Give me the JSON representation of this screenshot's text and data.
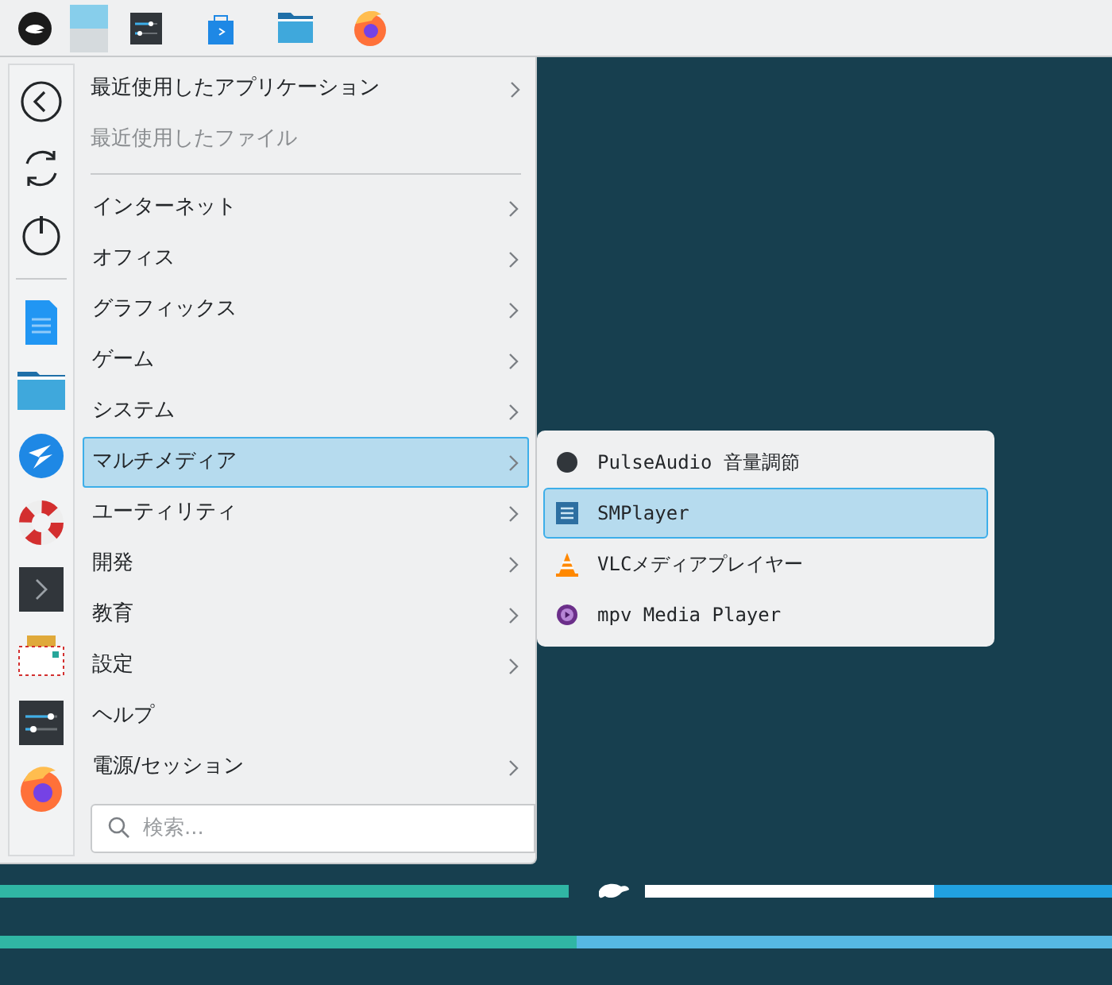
{
  "panel": {
    "pager": [
      {
        "selected": true
      },
      {
        "selected": false
      }
    ]
  },
  "menu": {
    "recent": [
      {
        "label": "最近使用したアプリケーション",
        "has_submenu": true,
        "disabled": false
      },
      {
        "label": "最近使用したファイル",
        "has_submenu": false,
        "disabled": true
      }
    ],
    "categories": [
      {
        "label": "インターネット",
        "has_submenu": true,
        "selected": false
      },
      {
        "label": "オフィス",
        "has_submenu": true,
        "selected": false
      },
      {
        "label": "グラフィックス",
        "has_submenu": true,
        "selected": false
      },
      {
        "label": "ゲーム",
        "has_submenu": true,
        "selected": false
      },
      {
        "label": "システム",
        "has_submenu": true,
        "selected": false
      },
      {
        "label": "マルチメディア",
        "has_submenu": true,
        "selected": true
      },
      {
        "label": "ユーティリティ",
        "has_submenu": true,
        "selected": false
      },
      {
        "label": "開発",
        "has_submenu": true,
        "selected": false
      },
      {
        "label": "教育",
        "has_submenu": true,
        "selected": false
      },
      {
        "label": "設定",
        "has_submenu": true,
        "selected": false
      },
      {
        "label": "ヘルプ",
        "has_submenu": false,
        "selected": false
      },
      {
        "label": "電源/セッション",
        "has_submenu": true,
        "selected": false
      }
    ],
    "search": {
      "placeholder": "検索..."
    }
  },
  "submenu": {
    "items": [
      {
        "label": "PulseAudio 音量調節",
        "selected": false
      },
      {
        "label": "SMPlayer",
        "selected": true
      },
      {
        "label": "VLCメディアプレイヤー",
        "selected": false
      },
      {
        "label": "mpv Media Player",
        "selected": false
      }
    ]
  }
}
